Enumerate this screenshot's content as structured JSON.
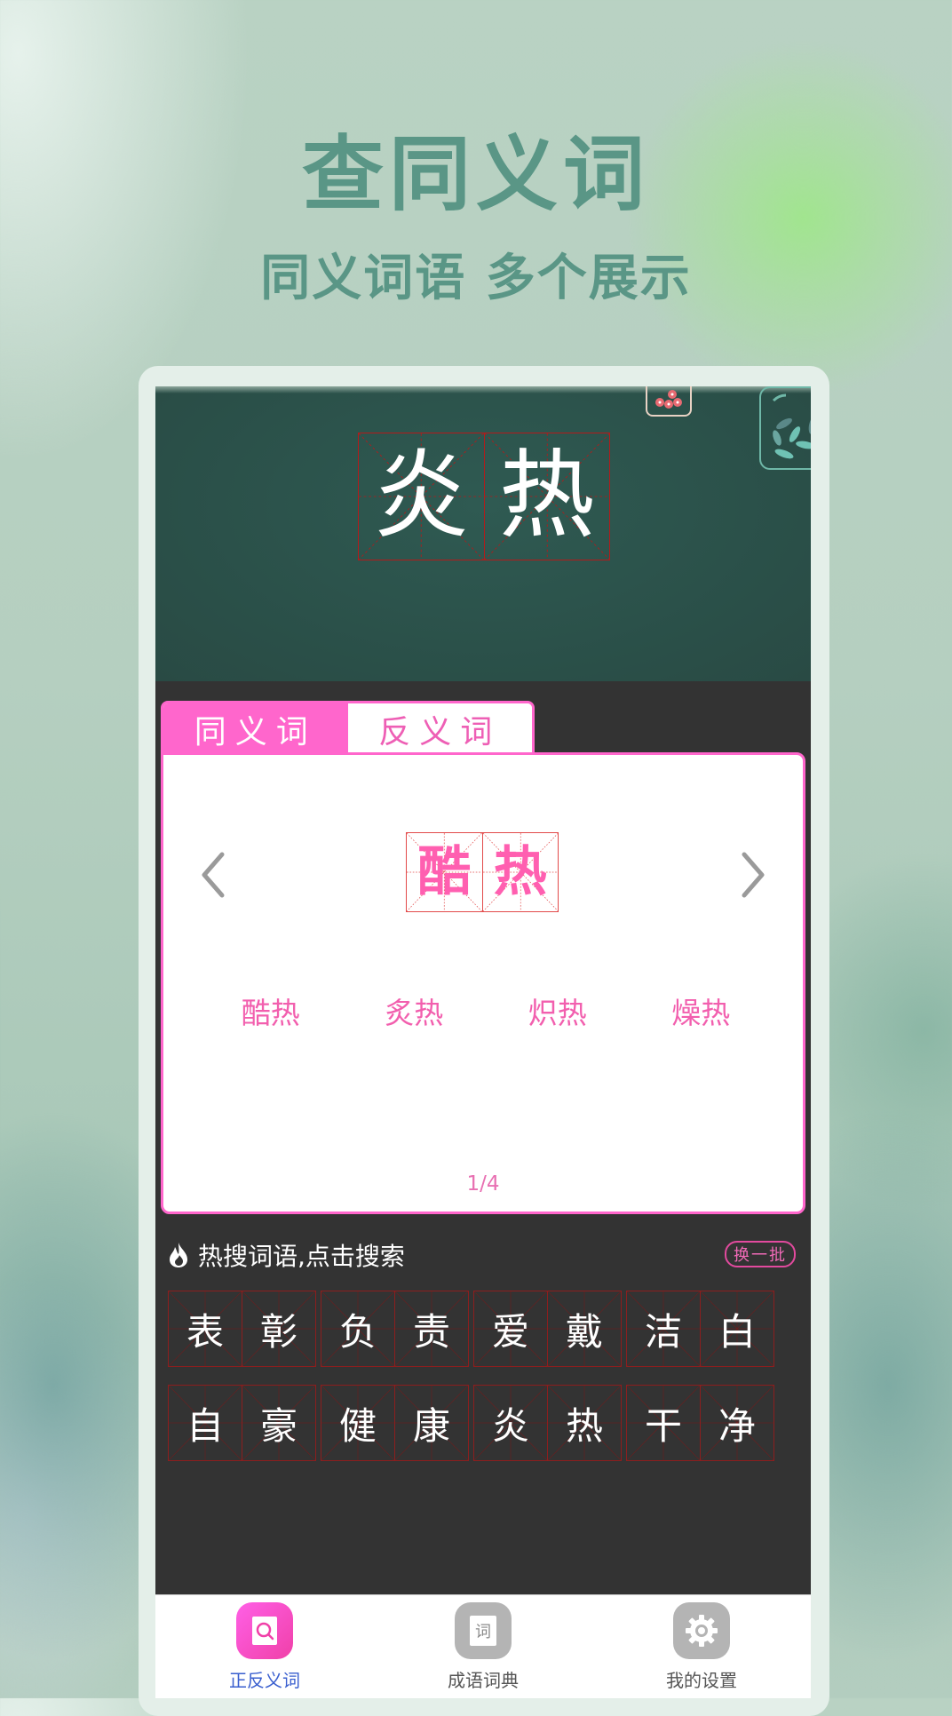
{
  "promo": {
    "title": "查同义词",
    "subtitle": "同义词语 多个展示",
    "text_color": "#5a9686"
  },
  "board": {
    "word_chars": [
      "炎",
      "热"
    ]
  },
  "tabs": [
    {
      "label": "同义词",
      "active": true
    },
    {
      "label": "反义词",
      "active": false
    }
  ],
  "synonym_card": {
    "current_word_chars": [
      "酷",
      "热"
    ],
    "prev_icon": "chevron-left-icon",
    "next_icon": "chevron-right-icon",
    "synonyms": [
      "酷热",
      "炙热",
      "炽热",
      "燥热"
    ],
    "pager": "1/4",
    "accent_color": "#ff66cc"
  },
  "hot_search": {
    "icon": "flame-icon",
    "title": "热搜词语,点击搜索",
    "refresh_label": "换一批",
    "rows": [
      [
        [
          "表",
          "彰"
        ],
        [
          "负",
          "责"
        ],
        [
          "爱",
          "戴"
        ],
        [
          "洁",
          "白"
        ]
      ],
      [
        [
          "自",
          "豪"
        ],
        [
          "健",
          "康"
        ],
        [
          "炎",
          "热"
        ],
        [
          "干",
          "净"
        ]
      ]
    ]
  },
  "tabbar": {
    "items": [
      {
        "label": "正反义词",
        "icon": "search-book-icon",
        "active": true
      },
      {
        "label": "成语词典",
        "icon": "dictionary-icon",
        "icon_text": "词",
        "active": false
      },
      {
        "label": "我的设置",
        "icon": "gear-icon",
        "active": false
      }
    ],
    "active_color": "#3a5fcf"
  }
}
